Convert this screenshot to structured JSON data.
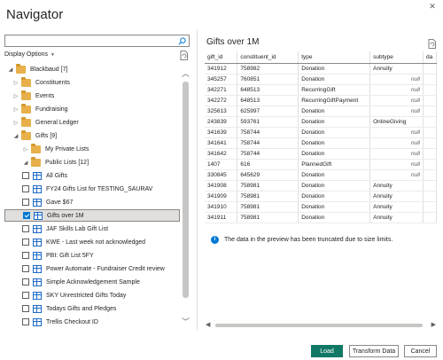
{
  "window": {
    "title": "Navigator",
    "close_glyph": "✕"
  },
  "search": {
    "value": "",
    "placeholder": ""
  },
  "display_options": {
    "label": "Display Options"
  },
  "tree": [
    {
      "label": "Blackbaud [7]",
      "type": "folder",
      "expander": "◢",
      "level": 0
    },
    {
      "label": "Constituents",
      "type": "folder",
      "expander": "▷",
      "level": 1
    },
    {
      "label": "Events",
      "type": "folder",
      "expander": "▷",
      "level": 1
    },
    {
      "label": "Fundraising",
      "type": "folder",
      "expander": "▷",
      "level": 1
    },
    {
      "label": "General Ledger",
      "type": "folder",
      "expander": "▷",
      "level": 1
    },
    {
      "label": "Gifts [9]",
      "type": "folder",
      "expander": "◢",
      "level": 1
    },
    {
      "label": "My Private Lists",
      "type": "folder",
      "expander": "▷",
      "level": 2
    },
    {
      "label": "Public Lists [12]",
      "type": "folder",
      "expander": "◢",
      "level": 2
    },
    {
      "label": "All Gifts",
      "type": "table",
      "checked": false,
      "level": 3
    },
    {
      "label": "FY24 Gifts List for TESTING_SAURAV",
      "type": "table",
      "checked": false,
      "level": 3
    },
    {
      "label": "Gave $67",
      "type": "table",
      "checked": false,
      "level": 3
    },
    {
      "label": "Gifts over 1M",
      "type": "table",
      "checked": true,
      "selected": true,
      "level": 3
    },
    {
      "label": "JAF Skills Lab Gift List",
      "type": "table",
      "checked": false,
      "level": 3
    },
    {
      "label": "KWE - Last week not acknowledged",
      "type": "table",
      "checked": false,
      "level": 3
    },
    {
      "label": "PBI: Gift List 5FY",
      "type": "table",
      "checked": false,
      "level": 3
    },
    {
      "label": "Power Automate - Fundraiser Credit review",
      "type": "table",
      "checked": false,
      "level": 3
    },
    {
      "label": "Simple Acknowledgement Sample",
      "type": "table",
      "checked": false,
      "level": 3
    },
    {
      "label": "SKY Unrestricted Gifts Today",
      "type": "table",
      "checked": false,
      "level": 3
    },
    {
      "label": "Todays Gifts and Pledges",
      "type": "table",
      "checked": false,
      "level": 3
    },
    {
      "label": "Trellis Checkout ID",
      "type": "table",
      "checked": false,
      "level": 3
    }
  ],
  "preview": {
    "title": "Gifts over 1M",
    "columns": [
      "gift_id",
      "constituent_id",
      "type",
      "subtype",
      "da"
    ],
    "rows": [
      [
        "341912",
        "758982",
        "Donation",
        "Annuity",
        ""
      ],
      [
        "345257",
        "760851",
        "Donation",
        "null",
        ""
      ],
      [
        "342271",
        "648513",
        "RecurringGift",
        "null",
        ""
      ],
      [
        "342272",
        "648513",
        "RecurringGiftPayment",
        "null",
        ""
      ],
      [
        "325613",
        "625997",
        "Donation",
        "null",
        ""
      ],
      [
        "243839",
        "593761",
        "Donation",
        "OnlineGiving",
        ""
      ],
      [
        "341639",
        "758744",
        "Donation",
        "null",
        ""
      ],
      [
        "341641",
        "758744",
        "Donation",
        "null",
        ""
      ],
      [
        "341642",
        "758744",
        "Donation",
        "null",
        ""
      ],
      [
        "1407",
        "616",
        "PlannedGift",
        "null",
        ""
      ],
      [
        "330845",
        "645629",
        "Donation",
        "null",
        ""
      ],
      [
        "341908",
        "758981",
        "Donation",
        "Annuity",
        ""
      ],
      [
        "341909",
        "758981",
        "Donation",
        "Annuity",
        ""
      ],
      [
        "341910",
        "758981",
        "Donation",
        "Annuity",
        ""
      ],
      [
        "341911",
        "758981",
        "Donation",
        "Annuity",
        ""
      ]
    ],
    "info_text": "The data in the preview has been truncated due to size limits."
  },
  "buttons": {
    "load": "Load",
    "transform": "Transform Data",
    "cancel": "Cancel"
  },
  "colors": {
    "primary": "#117865",
    "folder": "#e8b04b",
    "accent": "#0078d4"
  }
}
